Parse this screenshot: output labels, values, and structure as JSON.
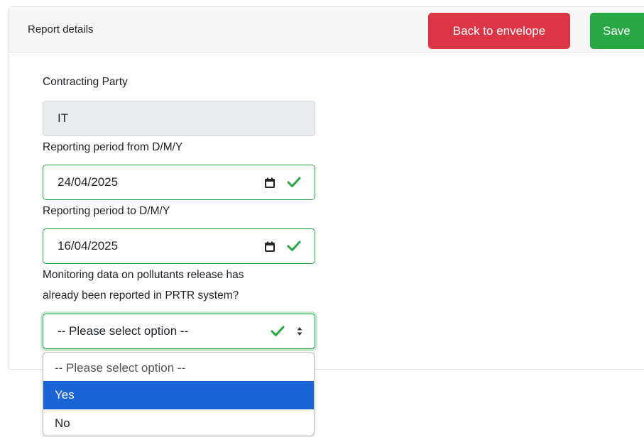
{
  "header": {
    "title": "Report details",
    "back_label": "Back to envelope",
    "save_label": "Save"
  },
  "form": {
    "contracting_party": {
      "label": "Contracting Party",
      "value": "IT"
    },
    "period_from": {
      "label": "Reporting period from D/M/Y",
      "value": "24/04/2025"
    },
    "period_to": {
      "label": "Reporting period to D/M/Y",
      "value": "16/04/2025"
    },
    "monitoring": {
      "label_line1": "Monitoring data on pollutants release has",
      "label_line2": "already been reported in PRTR system?",
      "value": "-- Please select option --",
      "options": [
        "-- Please select option --",
        "Yes",
        "No"
      ],
      "highlighted": "Yes"
    }
  },
  "colors": {
    "danger": "#dc3545",
    "success": "#28a745",
    "highlight": "#1a64d8"
  },
  "icons": {
    "calendar": "calendar-icon",
    "check": "check-icon",
    "sort": "sort-icon"
  }
}
